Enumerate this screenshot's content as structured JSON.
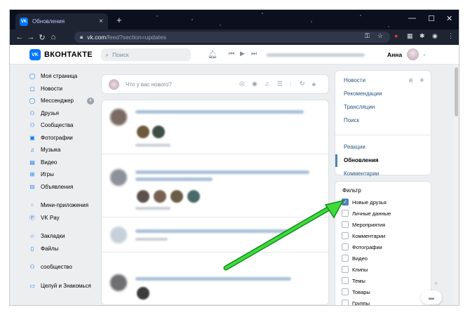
{
  "browser": {
    "tab_title": "Обновления",
    "tab_icon": "VK",
    "tab_close": "×",
    "new_tab": "+",
    "minimize": "—",
    "maximize": "☐",
    "close": "✕",
    "url_host": "vk.com",
    "url_path": "/feed?section=updates"
  },
  "header": {
    "logo_badge": "VK",
    "logo_text": "ВКОНТАКТЕ",
    "search_placeholder": "Поиск",
    "user_name": "Анна"
  },
  "sidebar": {
    "items": [
      {
        "label": "Моя страница",
        "icon": "user-circle-icon",
        "glyph": "◯"
      },
      {
        "label": "Новости",
        "icon": "news-icon",
        "glyph": "▢"
      },
      {
        "label": "Мессенджер",
        "icon": "chat-icon",
        "glyph": "◯",
        "badge": "4"
      },
      {
        "label": "Друзья",
        "icon": "friend-icon",
        "glyph": "⚇"
      },
      {
        "label": "Сообщества",
        "icon": "community-icon",
        "glyph": "⚇"
      },
      {
        "label": "Фотографии",
        "icon": "photo-icon",
        "glyph": "▣"
      },
      {
        "label": "Музыка",
        "icon": "music-icon",
        "glyph": "♫"
      },
      {
        "label": "Видео",
        "icon": "video-icon",
        "glyph": "▤"
      },
      {
        "label": "Игры",
        "icon": "game-icon",
        "glyph": "⊞"
      },
      {
        "label": "Объявления",
        "icon": "ads-icon",
        "glyph": "⊟"
      }
    ],
    "items2": [
      {
        "label": "Мини-приложения",
        "icon": "apps-icon",
        "glyph": "⁘"
      },
      {
        "label": "VK Pay",
        "icon": "vkpay-icon",
        "glyph": "Ⓟ"
      }
    ],
    "items3": [
      {
        "label": "Закладки",
        "icon": "bookmark-icon",
        "glyph": "☆"
      },
      {
        "label": "Файлы",
        "icon": "file-icon",
        "glyph": "▯"
      }
    ],
    "items4": [
      {
        "label": "сообщество",
        "icon": "community-icon",
        "glyph": "⚇"
      }
    ],
    "items5": [
      {
        "label": "Целуй и Знакомься",
        "icon": "app-icon",
        "glyph": "▭"
      }
    ]
  },
  "compose": {
    "placeholder": "Что у вас нового?"
  },
  "right_panel": {
    "nav": [
      "Новости",
      "Рекомендации",
      "Трансляции",
      "Поиск"
    ],
    "nav2": [
      "Реакции",
      "Обновления",
      "Комментарии"
    ],
    "active": "Обновления",
    "filter_title": "Фильтр",
    "filters": [
      {
        "label": "Новые друзья",
        "checked": true
      },
      {
        "label": "Личные данные",
        "checked": false
      },
      {
        "label": "Мероприятия",
        "checked": false
      },
      {
        "label": "Комментарии",
        "checked": false
      },
      {
        "label": "Фотографии",
        "checked": false
      },
      {
        "label": "Видео",
        "checked": false
      },
      {
        "label": "Клипы",
        "checked": false
      },
      {
        "label": "Темы",
        "checked": false
      },
      {
        "label": "Товары",
        "checked": false
      },
      {
        "label": "Группы",
        "checked": false
      }
    ]
  },
  "colors": {
    "accent": "#0077ff",
    "link": "#2a5885",
    "arrow": "#2ecc40"
  }
}
